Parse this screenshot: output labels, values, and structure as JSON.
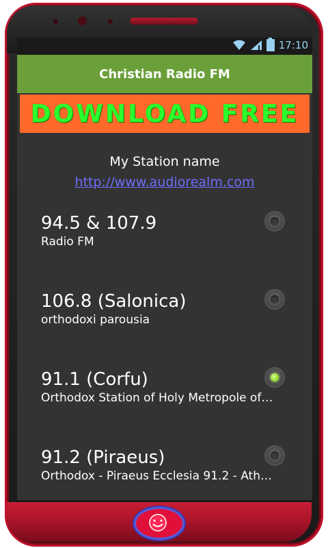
{
  "status": {
    "time": "17:10"
  },
  "app": {
    "title": "Christian Radio FM"
  },
  "banner": {
    "text": "DOWNLOAD  FREE"
  },
  "station": {
    "name": "My Station name",
    "link": "http://www.audiorealm.com"
  },
  "stations": [
    {
      "freq": "94.5 & 107.9",
      "desc": "Radio FM",
      "selected": false
    },
    {
      "freq": "106.8 (Salonica)",
      "desc": "orthodoxi parousia",
      "selected": false
    },
    {
      "freq": "91.1 (Corfu)",
      "desc": "Orthodox Station of Holy Metropole of…",
      "selected": true
    },
    {
      "freq": "91.2 (Piraeus)",
      "desc": "Orthodox - Piraeus Ecclesia 91.2 - Ath…",
      "selected": false
    }
  ],
  "icons": {
    "wifi": "wifi-icon",
    "signal": "signal-icon",
    "battery": "battery-icon",
    "home": "home-smiley-icon"
  },
  "colors": {
    "appbar": "#6a9f3a",
    "banner_bg": "#ff6a2a",
    "banner_text": "#2cff2c",
    "screen_bg": "#333333",
    "phone_accent": "#c0122b"
  }
}
